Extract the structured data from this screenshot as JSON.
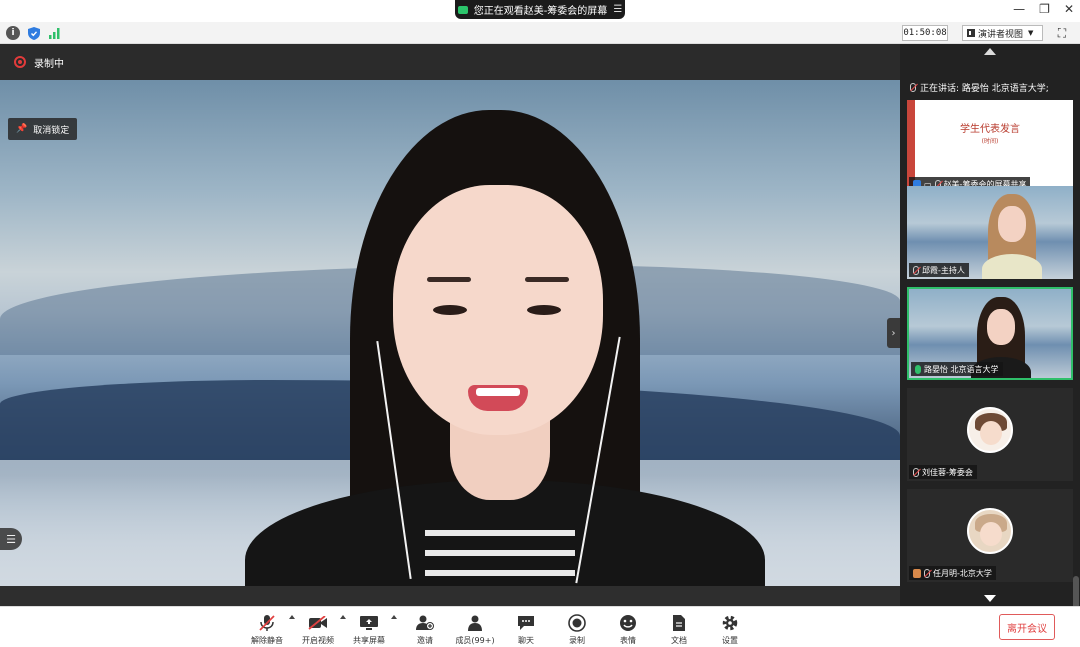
{
  "title_bar": {
    "share_banner": "您正在观看赵美-筹委会的屏幕",
    "window_controls": [
      "minimize",
      "restore",
      "close"
    ]
  },
  "info_bar": {
    "timer": "01:50:08",
    "view_mode": "演讲者视图"
  },
  "main": {
    "recording_label": "录制中",
    "unpin_label": "取消锁定"
  },
  "sidebar": {
    "speaking": "正在讲话: 路晏怡 北京语言大学;",
    "tiles": [
      {
        "label": "赵美-筹委会的屏幕共享",
        "slide_title": "学生代表发言",
        "slide_sub": "(时间)",
        "type": "screen"
      },
      {
        "label": "邱霞-主持人",
        "type": "video"
      },
      {
        "label": "路晏怡 北京语言大学",
        "type": "video-active"
      },
      {
        "label": "刘佳蓉-筹委会",
        "type": "avatar"
      },
      {
        "label": "任月明-北京大学",
        "type": "avatar-photo"
      }
    ]
  },
  "toolbar": {
    "unmute": "解除静音",
    "start_video": "开启视频",
    "share_screen": "共享屏幕",
    "invite": "邀请",
    "members": "成员(99+)",
    "chat": "聊天",
    "record": "录制",
    "reactions": "表情",
    "docs": "文档",
    "settings": "设置",
    "leave": "离开会议"
  },
  "colors": {
    "accent_green": "#2fbf6a",
    "record_red": "#e23b3b",
    "leave_red": "#e04040"
  }
}
